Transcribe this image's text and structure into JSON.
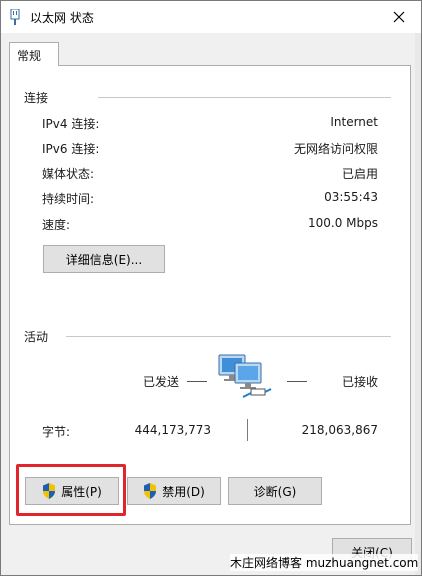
{
  "window": {
    "title": "以太网 状态"
  },
  "tabs": [
    {
      "label": "常规"
    }
  ],
  "connection": {
    "heading": "连接",
    "rows": [
      {
        "label": "IPv4 连接:",
        "value": "Internet"
      },
      {
        "label": "IPv6 连接:",
        "value": "无网络访问权限"
      },
      {
        "label": "媒体状态:",
        "value": "已启用"
      },
      {
        "label": "持续时间:",
        "value": "03:55:43"
      },
      {
        "label": "速度:",
        "value": "100.0 Mbps"
      }
    ],
    "details_button": "详细信息(E)..."
  },
  "activity": {
    "heading": "活动",
    "sent_label": "已发送",
    "received_label": "已接收",
    "bytes_label": "字节:",
    "bytes_sent": "444,173,773",
    "bytes_received": "218,063,867"
  },
  "buttons": {
    "properties": "属性(P)",
    "disable": "禁用(D)",
    "diagnose": "诊断(G)",
    "close": "关闭(C)"
  },
  "watermark": "木庄网络博客 muzhuangnet.com",
  "colors": {
    "highlight": "#e0262c",
    "button_bg": "#e1e1e1",
    "panel_border": "#adadad"
  }
}
